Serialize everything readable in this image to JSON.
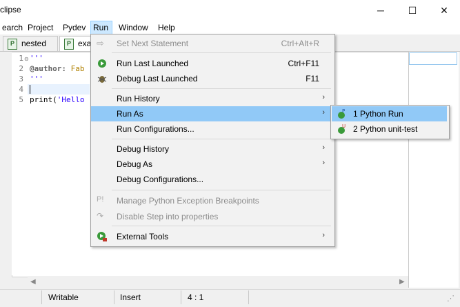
{
  "window": {
    "title": "clipse",
    "minimize": "─",
    "maximize": "☐",
    "close": "✕"
  },
  "menubar": [
    {
      "label": "earch"
    },
    {
      "label": "Project"
    },
    {
      "label": "Pydev"
    },
    {
      "label": "Run"
    },
    {
      "label": "Window"
    },
    {
      "label": "Help"
    }
  ],
  "tabs": [
    {
      "label": "nested",
      "icon": "python-file-icon"
    },
    {
      "label": "exa",
      "icon": "python-file-icon"
    }
  ],
  "editor": {
    "line_numbers": [
      "1",
      "2",
      "3",
      "4",
      "5"
    ],
    "line1": "'''",
    "line2_tag": "@author:",
    "line2_rest": " Fab",
    "line3": "'''",
    "line5_fn": "print(",
    "line5_str": "'Hello"
  },
  "run_menu": {
    "items": [
      {
        "label": "Set Next Statement",
        "accelerator": "Ctrl+Alt+R",
        "disabled": true,
        "icon": "arrow-right-icon"
      },
      {
        "label": "Run Last Launched",
        "accelerator": "Ctrl+F11",
        "icon": "run-icon"
      },
      {
        "label": "Debug Last Launched",
        "accelerator": "F11",
        "icon": "debug-icon"
      },
      {
        "label": "Run History",
        "submenu": true
      },
      {
        "label": "Run As",
        "submenu": true,
        "highlighted": true
      },
      {
        "label": "Run Configurations..."
      },
      {
        "label": "Debug History",
        "submenu": true
      },
      {
        "label": "Debug As",
        "submenu": true
      },
      {
        "label": "Debug Configurations..."
      },
      {
        "label": "Manage Python Exception Breakpoints",
        "disabled": true,
        "icon": "python-exception-icon"
      },
      {
        "label": "Disable Step into properties",
        "disabled": true,
        "icon": "step-disable-icon"
      },
      {
        "label": "External Tools",
        "submenu": true,
        "icon": "external-tools-icon"
      }
    ]
  },
  "run_as_submenu": [
    {
      "label": "1 Python Run",
      "highlighted": true,
      "icon": "python-run-icon"
    },
    {
      "label": "2 Python unit-test",
      "icon": "python-unittest-icon"
    }
  ],
  "statusbar": {
    "mode": "Writable",
    "insert": "Insert",
    "position": "4 : 1"
  },
  "colors": {
    "menu_highlight": "#91c9f7",
    "menubar_active": "#cce8ff",
    "string": "#2a00ff",
    "annotation": "#646464"
  }
}
